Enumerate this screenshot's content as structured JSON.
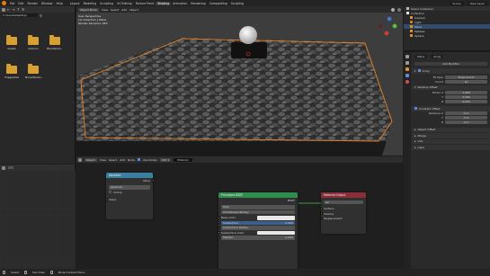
{
  "topbar": {
    "menus": [
      "File",
      "Edit",
      "Render",
      "Window",
      "Help"
    ],
    "tabs": [
      "Layout",
      "Modeling",
      "Sculpting",
      "UV Editing",
      "Texture Paint",
      "Shading",
      "Animation",
      "Rendering",
      "Compositing",
      "Scripting"
    ],
    "active_tab_index": 5,
    "scene_label": "Scene",
    "view_layer_label": "View Layer"
  },
  "filebrowser": {
    "path": "C:\\Users\\Desktop\\",
    "folders": [
      "Assets",
      "Autumn",
      "Blenderkit...",
      "Images/tex",
      "Nous/Studio..."
    ]
  },
  "viewport": {
    "header_items": [
      "Object Mode",
      "View",
      "Select",
      "Add",
      "Object"
    ],
    "info_lines": [
      "User Perspective",
      "(1) Collection | Plane",
      "Render Sampled: 650"
    ],
    "colors": {
      "floor": "#4a4a4a",
      "selection": "#e3822b",
      "sphere": "#d9d9d9"
    }
  },
  "outliner": {
    "title": "Scene Collection",
    "items": [
      {
        "label": "Collection",
        "indent": 0,
        "selected": false
      },
      {
        "label": "Camera",
        "indent": 1,
        "selected": false
      },
      {
        "label": "Light",
        "indent": 1,
        "selected": false
      },
      {
        "label": "Plane",
        "indent": 1,
        "selected": true
      },
      {
        "label": "Pebbles",
        "indent": 1,
        "selected": false
      },
      {
        "label": "Sphere",
        "indent": 1,
        "selected": false
      }
    ]
  },
  "properties": {
    "object_name": "Plane",
    "modifier_tab": "Array",
    "add_modifier": "Add Modifier",
    "rows": [
      {
        "label": "Fit Type",
        "value": "Fixed Count"
      },
      {
        "label": "Count",
        "value": "10"
      }
    ],
    "section_relative": "Relative Offset",
    "relative_factors": [
      {
        "label": "Factor X",
        "value": "1.000"
      },
      {
        "label": "Y",
        "value": "0.000"
      },
      {
        "label": "Z",
        "value": "0.000"
      }
    ],
    "section_constant": "Constant Offset",
    "constant_distances": [
      {
        "label": "Distance X",
        "value": "0 m"
      },
      {
        "label": "Y",
        "value": "0 m"
      },
      {
        "label": "Z",
        "value": "0 m"
      }
    ],
    "collapsed_sections": [
      "Object Offset",
      "Merge",
      "UVs",
      "Caps"
    ]
  },
  "nodeeditor": {
    "header_items": [
      "Object",
      "View",
      "Select",
      "Add",
      "Node",
      "Use Nodes",
      "Slot 1",
      "Material"
    ],
    "absolute_node": {
      "title": "Absolute",
      "output": "Value",
      "operation": "Absolute",
      "clamp_label": "Clamp",
      "input": "Value"
    },
    "principled_node": {
      "title": "Principled BSDF",
      "output": "BSDF",
      "distribution": "GGX",
      "subsurface_method": "Christensen-Burley",
      "inputs": [
        {
          "label": "Base Color",
          "value": ""
        },
        {
          "label": "Subsurface",
          "value": "0.000"
        },
        {
          "label": "Subsurface Radius",
          "value": ""
        },
        {
          "label": "Subsurface Color",
          "value": ""
        },
        {
          "label": "Metallic",
          "value": "0.000"
        }
      ]
    },
    "output_node": {
      "title": "Material Output",
      "target": "All",
      "inputs": [
        "Surface",
        "Volume",
        "Displacement"
      ]
    },
    "colors": {
      "absolute_header": "#3b7f9e",
      "principled_header": "#2f8d4e",
      "output_header": "#8a2f3a",
      "socket_shader": "#56c45f",
      "socket_value": "#a1a1a1",
      "socket_color": "#c7c729",
      "socket_vector": "#6363c7"
    }
  },
  "statusbar": {
    "items": [
      "Select",
      "Pan View",
      "Node Context Menu"
    ]
  }
}
